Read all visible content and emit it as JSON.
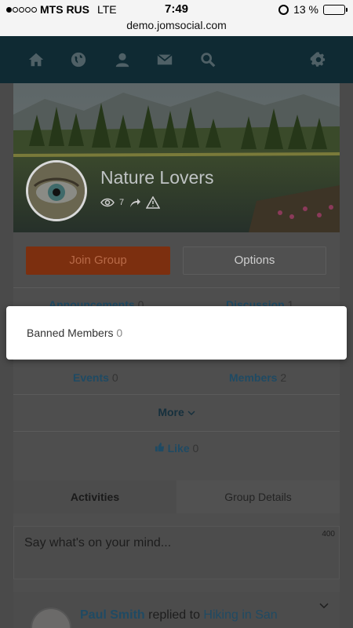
{
  "status_bar": {
    "carrier": "MTS RUS",
    "network": "LTE",
    "time": "7:49",
    "battery": "13 %",
    "battery_level": 0.13,
    "signal_bars": 1
  },
  "browser": {
    "url": "demo.jomsocial.com"
  },
  "nav": {
    "icons": [
      "home-icon",
      "globe-icon",
      "user-icon",
      "mail-icon",
      "search-icon",
      "gear-icon"
    ]
  },
  "group": {
    "title": "Nature Lovers",
    "views": "7"
  },
  "actions": {
    "join_label": "Join Group",
    "options_label": "Options"
  },
  "stats": {
    "announcements_label": "Announcements",
    "announcements_count": "0",
    "discussion_label": "Discussion",
    "discussion_count": "1",
    "events_label": "Events",
    "events_count": "0",
    "members_label": "Members",
    "members_count": "2",
    "more_label": "More",
    "like_label": "Like",
    "like_count": "0"
  },
  "tabs": {
    "activities": "Activities",
    "group_details": "Group Details"
  },
  "composer": {
    "placeholder": "Say what's on your mind...",
    "counter": "400"
  },
  "post": {
    "author": "Paul Smith",
    "action": "replied to",
    "target": "Hiking in San"
  },
  "dialog": {
    "item_label": "Banned Members",
    "item_count": "0"
  },
  "colors": {
    "nav_bg": "#0f2a33",
    "join_bg": "#7c2f0f",
    "link": "#1f4a63",
    "battery_low": "#e0302a"
  }
}
